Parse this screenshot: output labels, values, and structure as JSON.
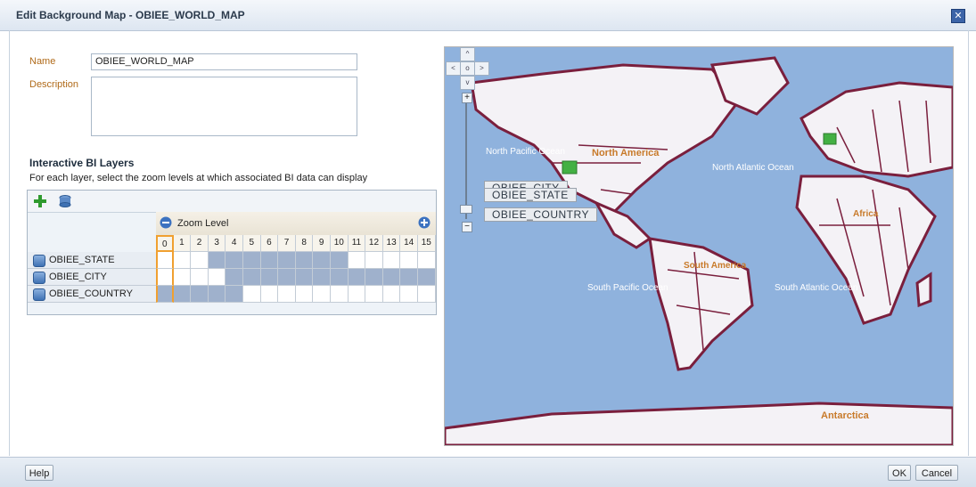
{
  "dialog": {
    "title": "Edit Background Map - OBIEE_WORLD_MAP",
    "close_glyph": "✕"
  },
  "form": {
    "name_label": "Name",
    "name_value": "OBIEE_WORLD_MAP",
    "description_label": "Description",
    "description_value": ""
  },
  "layers": {
    "heading": "Interactive BI Layers",
    "instruction": "For each layer, select the zoom levels at which associated BI data can display",
    "add_icon": "plus-icon",
    "db_icon": "database-icon",
    "zoom_level_label": "Zoom Level",
    "zoom_levels": [
      "0",
      "1",
      "2",
      "3",
      "4",
      "5",
      "6",
      "7",
      "8",
      "9",
      "10",
      "11",
      "12",
      "13",
      "14",
      "15"
    ],
    "rows": [
      {
        "name": "OBIEE_STATE",
        "enabled": [
          3,
          4,
          5,
          6,
          7,
          8,
          9,
          10
        ]
      },
      {
        "name": "OBIEE_CITY",
        "enabled": [
          4,
          5,
          6,
          7,
          8,
          9,
          10,
          11,
          12,
          13,
          14,
          15
        ]
      },
      {
        "name": "OBIEE_COUNTRY",
        "enabled": [
          0,
          1,
          2,
          3,
          4
        ]
      }
    ]
  },
  "map": {
    "nav_glyphs": {
      "up": "^",
      "down": "v",
      "left": "<",
      "right": ">",
      "center": "o"
    },
    "zoom_in": "+",
    "zoom_out": "−",
    "layer_tags": [
      "OBIEE_CITY",
      "OBIEE_STATE",
      "OBIEE_COUNTRY"
    ],
    "labels": [
      "North America",
      "South America",
      "North Pacific Ocean",
      "North Atlantic Ocean",
      "South Pacific Ocean",
      "South Atlantic Ocean",
      "Antarctica",
      "Africa"
    ],
    "colors": {
      "ocean": "#8fb2dd",
      "land": "#f4f2f6",
      "border": "#7a1f3d",
      "label": "#c87a2a"
    }
  },
  "footer": {
    "help": "Help",
    "ok": "OK",
    "cancel": "Cancel"
  }
}
